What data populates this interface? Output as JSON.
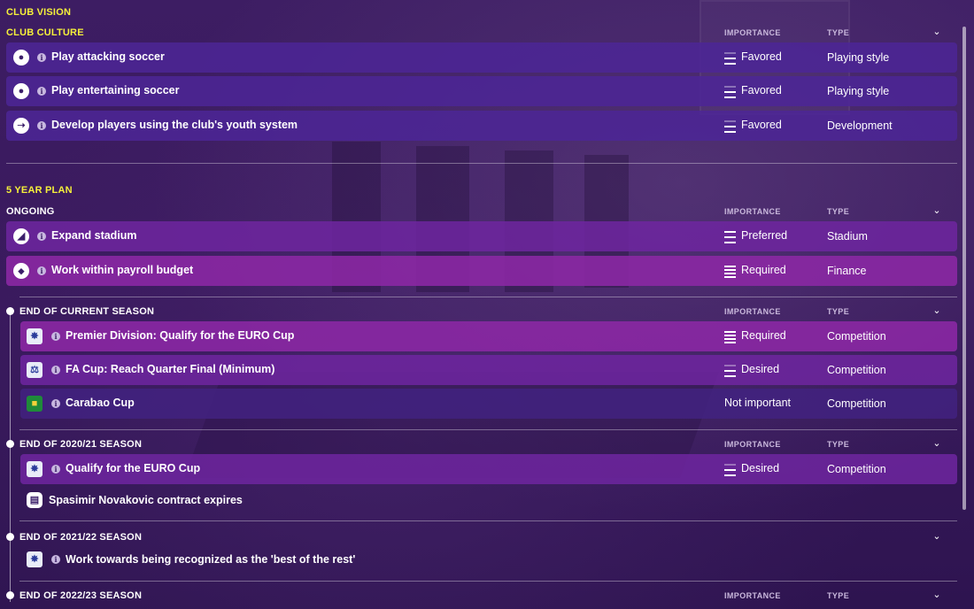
{
  "club_vision": {
    "title": "CLUB VISION",
    "club_culture": {
      "title": "CLUB CULTURE",
      "columns": {
        "importance": "IMPORTANCE",
        "type": "TYPE"
      },
      "rows": [
        {
          "icon": "soccer-ball-icon",
          "label": "Play attacking soccer",
          "importance": "Favored",
          "importance_level": 2,
          "type": "Playing style"
        },
        {
          "icon": "soccer-ball-icon",
          "label": "Play entertaining soccer",
          "importance": "Favored",
          "importance_level": 2,
          "type": "Playing style"
        },
        {
          "icon": "youth-development-icon",
          "label": "Develop players using the club's youth system",
          "importance": "Favored",
          "importance_level": 2,
          "type": "Development"
        }
      ]
    }
  },
  "five_year_plan": {
    "title": "5 YEAR PLAN",
    "ongoing": {
      "title": "ONGOING",
      "columns": {
        "importance": "IMPORTANCE",
        "type": "TYPE"
      },
      "rows": [
        {
          "icon": "stadium-icon",
          "label": "Expand stadium",
          "importance": "Preferred",
          "importance_level": 3,
          "type": "Stadium"
        },
        {
          "icon": "finance-icon",
          "label": "Work within payroll budget",
          "importance": "Required",
          "importance_level": 4,
          "type": "Finance"
        }
      ]
    },
    "end_current": {
      "title": "END OF CURRENT SEASON",
      "columns": {
        "importance": "IMPORTANCE",
        "type": "TYPE"
      },
      "rows": [
        {
          "icon": "premier-division-icon",
          "label": "Premier Division: Qualify for the EURO Cup",
          "importance": "Required",
          "importance_level": 4,
          "type": "Competition"
        },
        {
          "icon": "fa-cup-icon",
          "label": "FA Cup: Reach Quarter Final (Minimum)",
          "importance": "Desired",
          "importance_level": 2,
          "type": "Competition"
        },
        {
          "icon": "carabao-cup-icon",
          "label": "Carabao Cup",
          "importance": "Not important",
          "importance_level": 0,
          "type": "Competition"
        }
      ]
    },
    "end_2021": {
      "title": "END OF 2020/21 SEASON",
      "columns": {
        "importance": "IMPORTANCE",
        "type": "TYPE"
      },
      "rows": [
        {
          "icon": "premier-division-icon",
          "label": "Qualify for the EURO Cup",
          "importance": "Desired",
          "importance_level": 2,
          "type": "Competition"
        }
      ],
      "note": {
        "icon": "contract-icon",
        "label": "Spasimir Novakovic contract expires"
      }
    },
    "end_2122": {
      "title": "END OF 2021/22 SEASON",
      "note": {
        "icon": "premier-division-icon",
        "label": "Work towards being recognized as the 'best of the rest'"
      }
    },
    "end_2223": {
      "title": "END OF 2022/23 SEASON",
      "columns": {
        "importance": "IMPORTANCE",
        "type": "TYPE"
      }
    }
  },
  "colors": {
    "section_title": "#f5f03a",
    "row_dark": "#4c2696",
    "row_pink": "#8c28a5",
    "background": "#3a1a5e"
  }
}
